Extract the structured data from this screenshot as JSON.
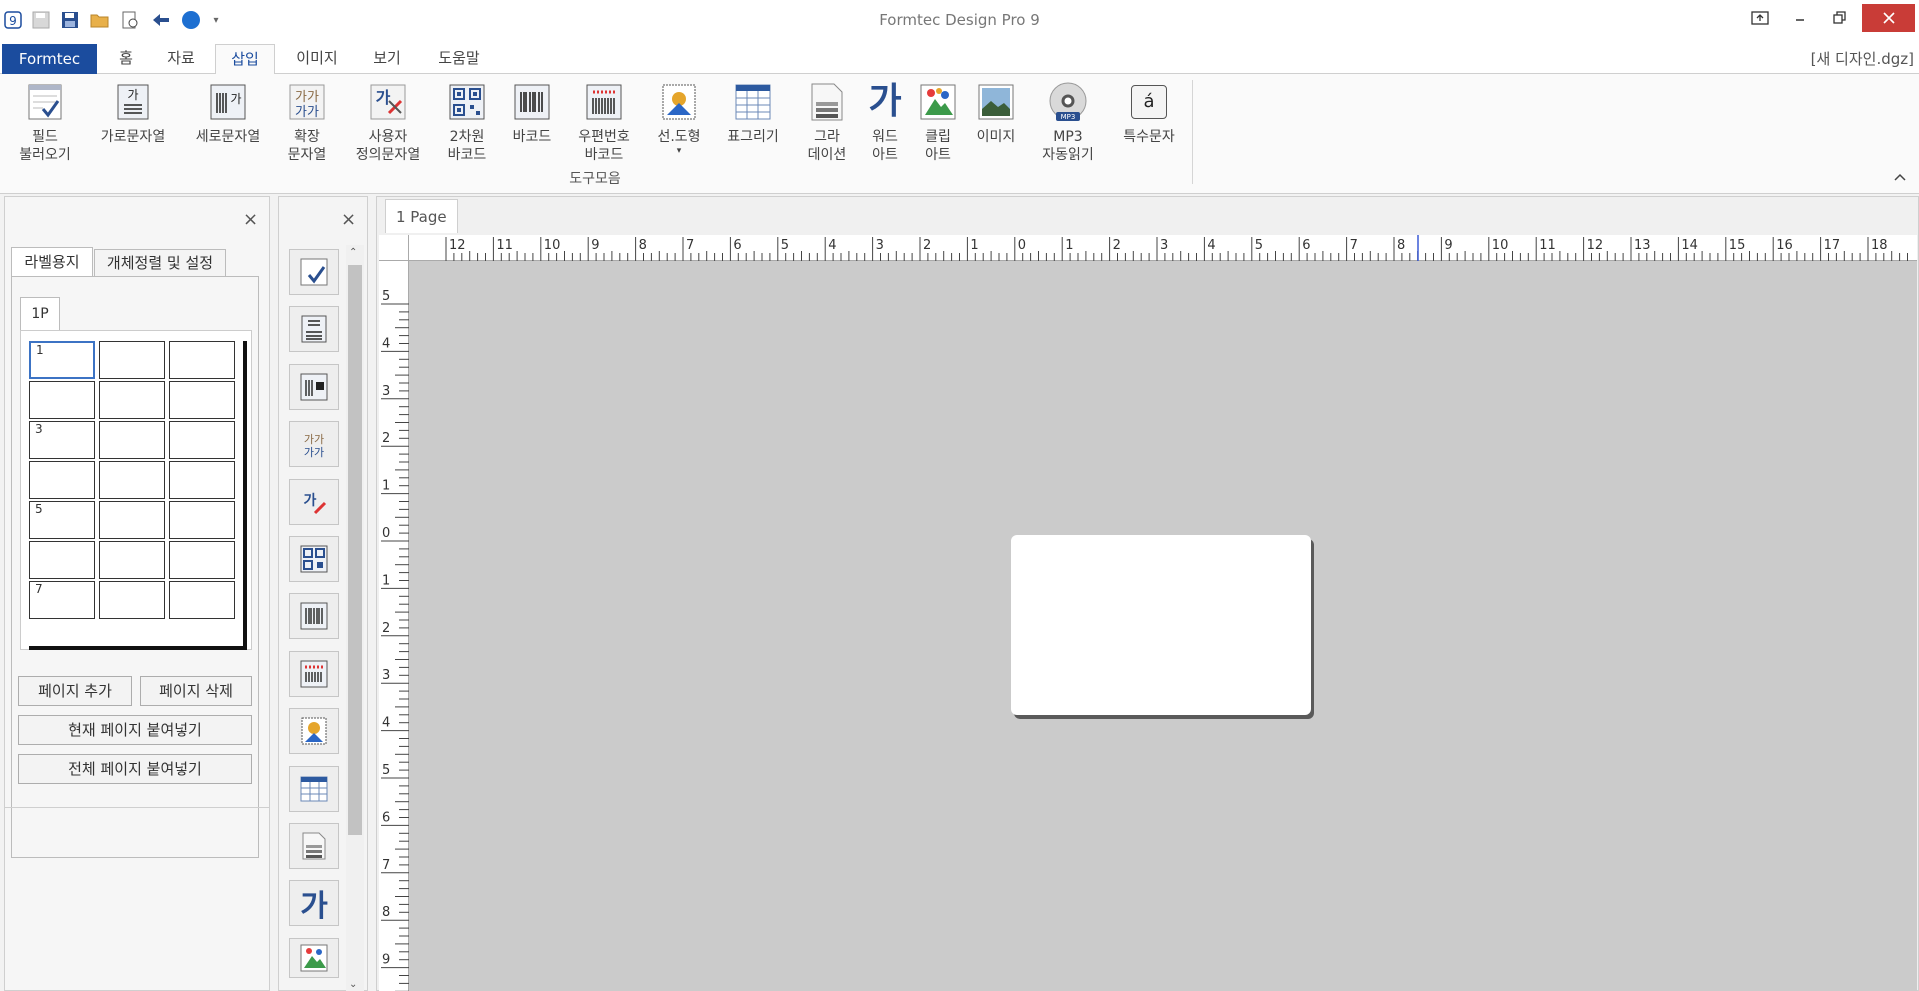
{
  "window": {
    "title": "Formtec Design Pro 9",
    "doc_name": "[새 디자인.dgz]"
  },
  "menu": {
    "file": "Formtec",
    "tabs": [
      "홈",
      "자료",
      "삽입",
      "이미지",
      "보기",
      "도움말"
    ],
    "active": "삽입"
  },
  "ribbon": {
    "items": [
      {
        "l1": "필드",
        "l2": "불러오기",
        "icon": "field-load-icon"
      },
      {
        "l1": "가로문자열",
        "l2": "",
        "icon": "horizontal-text-icon"
      },
      {
        "l1": "세로문자열",
        "l2": "",
        "icon": "vertical-text-icon"
      },
      {
        "l1": "확장",
        "l2": "문자열",
        "icon": "extended-text-icon"
      },
      {
        "l1": "사용자",
        "l2": "정의문자열",
        "icon": "custom-text-icon"
      },
      {
        "l1": "2차원",
        "l2": "바코드",
        "icon": "qr-code-icon"
      },
      {
        "l1": "바코드",
        "l2": "",
        "icon": "barcode-icon"
      },
      {
        "l1": "우편번호",
        "l2": "바코드",
        "icon": "postal-barcode-icon"
      },
      {
        "l1": "선.도형",
        "l2": "▾",
        "icon": "shape-icon"
      },
      {
        "l1": "표그리기",
        "l2": "",
        "icon": "table-icon"
      },
      {
        "l1": "그라",
        "l2": "데이션",
        "icon": "gradation-icon"
      },
      {
        "l1": "워드",
        "l2": "아트",
        "icon": "word-art-icon"
      },
      {
        "l1": "클립",
        "l2": "아트",
        "icon": "clip-art-icon"
      },
      {
        "l1": "이미지",
        "l2": "",
        "icon": "image-icon"
      },
      {
        "l1": "MP3",
        "l2": "자동읽기",
        "icon": "mp3-icon"
      },
      {
        "l1": "특수문자",
        "l2": "",
        "icon": "special-char-icon"
      }
    ],
    "group_label": "도구모음",
    "wordart_glyph": "가",
    "mp3_badge": "MP3",
    "special_glyph": "á",
    "hz_glyph": "가",
    "vt_glyph": "가"
  },
  "left_panel": {
    "tabs": [
      "라벨용지",
      "개체정렬 및 설정"
    ],
    "page_tab": "1P",
    "cell_numbers": [
      "1",
      "",
      "",
      "",
      "",
      "",
      "3",
      "",
      "",
      "",
      "",
      "",
      "5",
      "",
      "",
      "",
      "",
      "",
      "7",
      "",
      ""
    ],
    "buttons": {
      "add_page": "페이지 추가",
      "delete_page": "페이지 삭제",
      "paste_current": "현재 페이지 붙여넣기",
      "paste_all": "전체 페이지 붙여넣기"
    },
    "close": "×"
  },
  "toolstrip": {
    "close": "×",
    "wordart_glyph": "가"
  },
  "document": {
    "page_tab": "1 Page",
    "ruler_h": [
      "12",
      "11",
      "10",
      "9",
      "8",
      "7",
      "6",
      "5",
      "4",
      "3",
      "2",
      "1",
      "0",
      "1",
      "2",
      "3",
      "4",
      "5",
      "6",
      "7",
      "8",
      "9",
      "10",
      "11",
      "12",
      "13",
      "14",
      "15",
      "16",
      "17",
      "18"
    ],
    "ruler_v": [
      "5",
      "4",
      "3",
      "2",
      "1",
      "0",
      "1",
      "2",
      "3",
      "4",
      "5",
      "6",
      "7",
      "8",
      "9"
    ]
  },
  "colors": {
    "accent": "#1b4c9e",
    "close_red": "#c93c37",
    "canvas": "#cbcbcb"
  }
}
